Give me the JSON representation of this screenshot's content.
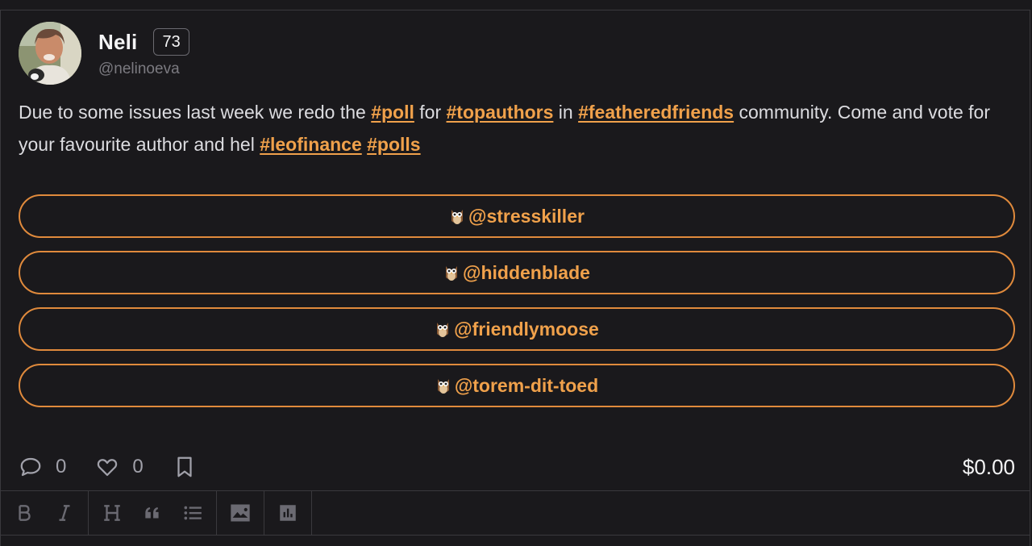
{
  "post": {
    "author_name": "Neli",
    "reputation": "73",
    "handle": "@nelinoeva",
    "text_parts": {
      "p1": "Due to some issues last week we redo the ",
      "tag1": "#poll",
      "p2": " for ",
      "tag2": "#topauthors",
      "p3": " in ",
      "tag3": "#featheredfriends",
      "p4": " community. Come and vote for your favourite author and hel ",
      "tag4": "#leofinance",
      "p5": " ",
      "tag5": "#polls"
    }
  },
  "poll": {
    "options": [
      {
        "label": "@stresskiller",
        "icon": "owl-emoji"
      },
      {
        "label": "@hiddenblade",
        "icon": "owl-emoji"
      },
      {
        "label": "@friendlymoose",
        "icon": "owl-emoji"
      },
      {
        "label": "@torem-dit-toed",
        "icon": "owl-emoji"
      }
    ]
  },
  "actions": {
    "comments_count": "0",
    "likes_count": "0",
    "payout": "$0.00"
  },
  "toolbar": {
    "buttons": [
      "bold-icon",
      "italic-icon",
      "heading-icon",
      "quote-icon",
      "list-icon",
      "image-icon",
      "poll-icon"
    ]
  },
  "colors": {
    "accent": "#f0a14b",
    "poll_border": "#e08a3c",
    "background": "#1a191c"
  }
}
